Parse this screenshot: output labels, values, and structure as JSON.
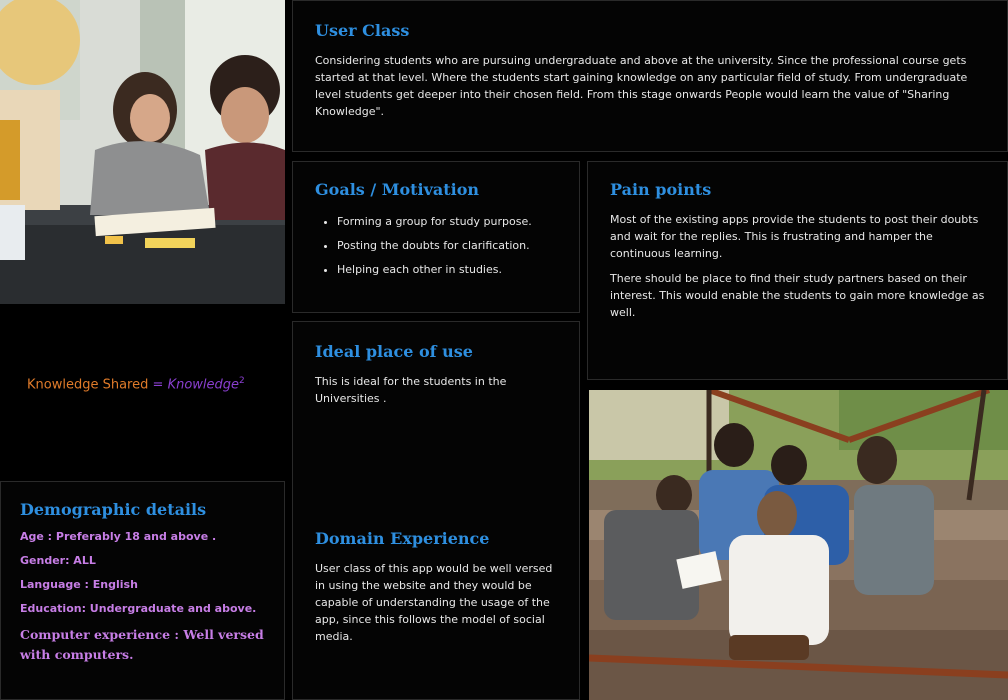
{
  "user_class": {
    "title": "User Class",
    "body": "Considering students who are pursuing undergraduate and above at the university. Since the professional course gets started at that level. Where the students start gaining knowledge on any particular field of study.  From undergraduate level students get deeper into their chosen field. From this stage onwards People would learn the value of \"Sharing Knowledge\"."
  },
  "goals": {
    "title": "Goals / Motivation",
    "items": [
      "Forming a group for study purpose.",
      "Posting the doubts for clarification.",
      "Helping each other in studies."
    ]
  },
  "pain_points": {
    "title": "Pain points",
    "para1": "Most of the existing apps provide the students to post their doubts and wait for the replies. This is frustrating and hamper the continuous learning.",
    "para2": "There should be place to find their study partners based on their interest. This would enable the students to gain more knowledge as well."
  },
  "ideal_place": {
    "title": "Ideal place of use",
    "body": "This is ideal for the students in the Universities ."
  },
  "domain_experience": {
    "title": "Domain Experience",
    "body": "User class of this app would be well versed in using the website and they would be capable of understanding the usage of the app, since this follows the model of social media."
  },
  "formula": {
    "left": "Knowledge Shared",
    "equals": "=",
    "right": "Knowledge",
    "exponent": "2"
  },
  "demographic": {
    "title": "Demographic details",
    "age": "Age : Preferably 18 and above .",
    "gender": "Gender: ALL",
    "language": "Language : English",
    "education": "Education: Undergraduate and above.",
    "computer": "Computer experience : Well versed with computers."
  },
  "colors": {
    "heading": "#2e8fe0",
    "formula_left": "#e07b2a",
    "formula_right": "#8a3fd0",
    "demographic_text": "#c77ee6"
  }
}
